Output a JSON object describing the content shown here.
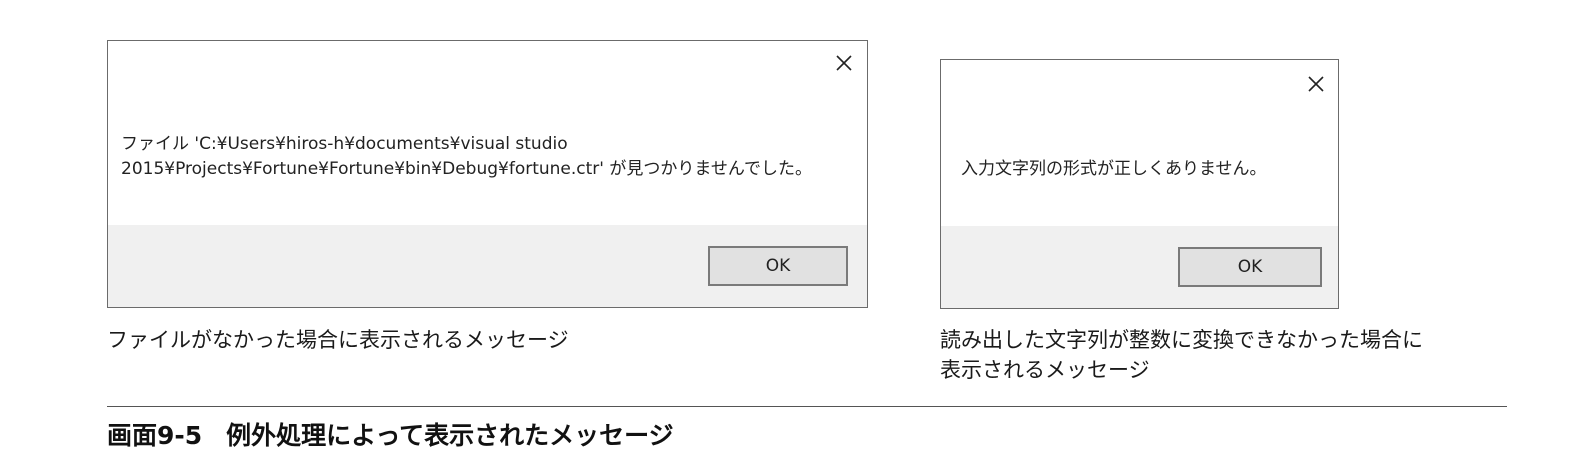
{
  "dialog_file_not_found": {
    "message_line1": "ファイル 'C:¥Users¥hiros-h¥documents¥visual studio",
    "message_line2": "2015¥Projects¥Fortune¥Fortune¥bin¥Debug¥fortune.ctr' が見つかりませんでした。",
    "ok_label": "OK",
    "close_icon": "close-icon"
  },
  "dialog_format_error": {
    "message": "入力文字列の形式が正しくありません。",
    "ok_label": "OK",
    "close_icon": "close-icon"
  },
  "captions": {
    "left": "ファイルがなかった場合に表示されるメッセージ",
    "right_line1": "読み出した文字列が整数に変換できなかった場合に",
    "right_line2": "表示されるメッセージ"
  },
  "figure": {
    "number": "画面9-5",
    "title": "例外処理によって表示されたメッセージ"
  },
  "colors": {
    "dialog_border": "#6b6b6b",
    "footer_background": "#f0f0f0",
    "button_background": "#e1e1e1",
    "button_border": "#7a7a7a"
  }
}
